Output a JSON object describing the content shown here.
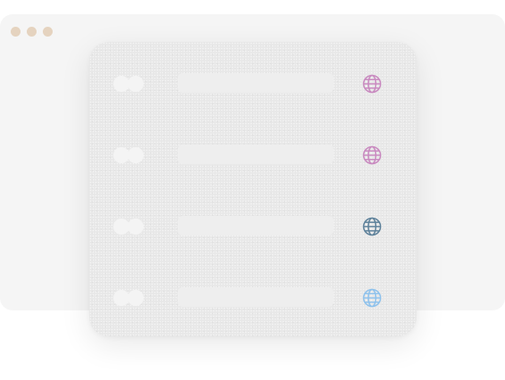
{
  "window": {
    "control_dots": [
      "close",
      "minimize",
      "maximize"
    ]
  },
  "panel": {
    "rows": [
      {
        "icon": "globe-icon",
        "icon_color": "#c98ac0"
      },
      {
        "icon": "globe-icon",
        "icon_color": "#c98ac0"
      },
      {
        "icon": "globe-icon",
        "icon_color": "#5f829b"
      },
      {
        "icon": "globe-icon",
        "icon_color": "#8fc2ec"
      }
    ]
  }
}
